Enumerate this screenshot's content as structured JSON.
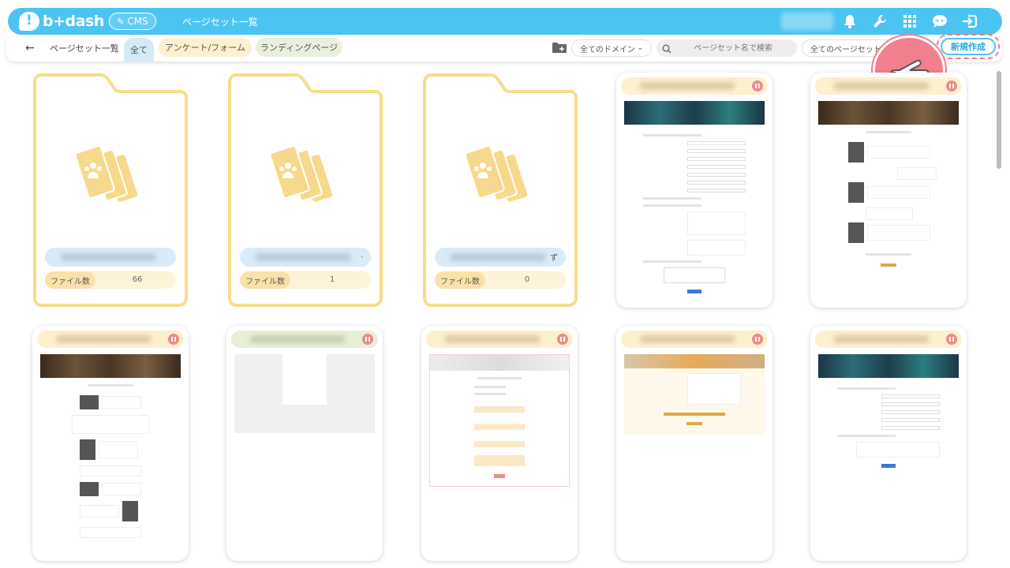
{
  "app": {
    "logo_text": "b+dash",
    "cms_label": "CMS",
    "page_title": "ページセット一覧"
  },
  "subbar": {
    "breadcrumb": "ページセット一覧",
    "tabs": [
      {
        "label": "全て"
      },
      {
        "label": "アンケート/フォーム"
      },
      {
        "label": "ランディングページ"
      }
    ],
    "domain_select": "全てのドメイン",
    "search_placeholder": "ページセット名で検索",
    "pageset_select": "全てのページセット",
    "new_button": "新規作成"
  },
  "folders": [
    {
      "count_label": "ファイル数",
      "count": "66",
      "name_tail": ""
    },
    {
      "count_label": "ファイル数",
      "count": "1",
      "name_tail": "."
    },
    {
      "count_label": "ファイル数",
      "count": "0",
      "name_tail": "ず"
    }
  ],
  "colors": {
    "brand": "#4cc4f2",
    "folder_border": "#f6dd8a",
    "folder_icon": "#f7d98d",
    "highlight": "#f07b8f"
  },
  "icons": [
    "bell-icon",
    "wrench-icon",
    "grid-icon",
    "chat-icon",
    "logout-icon",
    "folder-add-icon",
    "search-icon",
    "pointer-hand-icon"
  ]
}
